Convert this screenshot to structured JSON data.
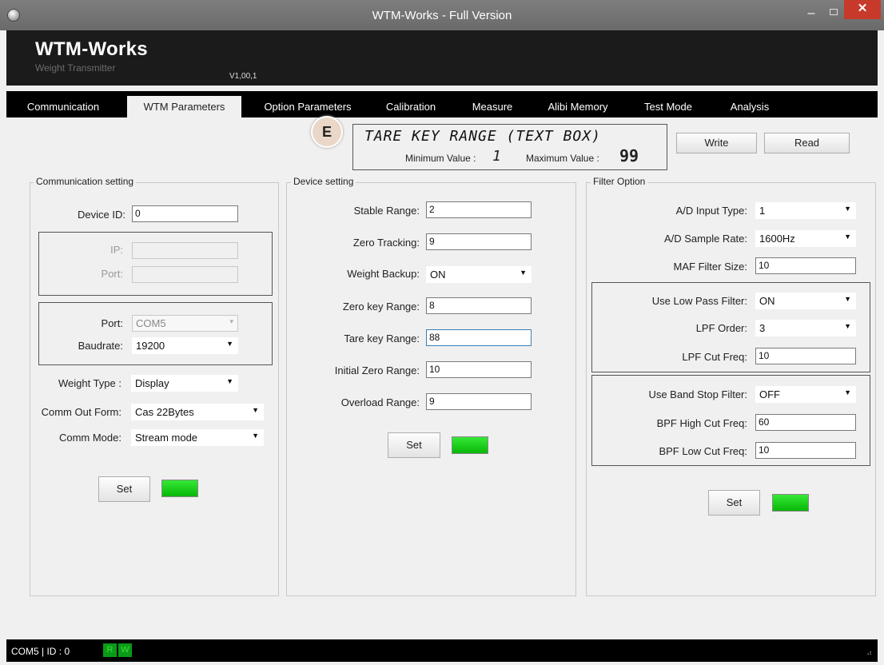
{
  "window": {
    "title": "WTM-Works - Full Version"
  },
  "header": {
    "name": "WTM-Works",
    "subtitle": "Weight Transmitter",
    "version": "V1,00,1"
  },
  "tabs": [
    "Communication",
    "WTM Parameters",
    "Option Parameters",
    "Calibration",
    "Measure",
    "Alibi Memory",
    "Test Mode",
    "Analysis"
  ],
  "active_tab": "WTM Parameters",
  "info_box": {
    "badge": "E",
    "title": "TARE KEY RANGE (TEXT BOX)",
    "min_label": "Minimum Value :",
    "min_value": "1",
    "max_label": "Maximum Value :",
    "max_value": "99"
  },
  "toolbar": {
    "write_label": "Write",
    "read_label": "Read"
  },
  "communication": {
    "legend": "Communication setting",
    "device_id_label": "Device ID:",
    "device_id_value": "0",
    "ip_label": "IP:",
    "ip_value": "",
    "port_net_label": "Port:",
    "port_net_value": "",
    "port_label": "Port:",
    "port_value": "COM5",
    "baudrate_label": "Baudrate:",
    "baudrate_value": "19200",
    "weight_type_label": "Weight Type :",
    "weight_type_value": "Display",
    "comm_out_label": "Comm Out Form:",
    "comm_out_value": "Cas 22Bytes",
    "comm_mode_label": "Comm Mode:",
    "comm_mode_value": "Stream mode",
    "set_label": "Set"
  },
  "device": {
    "legend": "Device setting",
    "stable_label": "Stable Range:",
    "stable_value": "2",
    "zero_tracking_label": "Zero Tracking:",
    "zero_tracking_value": "9",
    "weight_backup_label": "Weight Backup:",
    "weight_backup_value": "ON",
    "zero_key_label": "Zero key Range:",
    "zero_key_value": "8",
    "tare_key_label": "Tare key Range:",
    "tare_key_value": "88",
    "initial_zero_label": "Initial Zero Range:",
    "initial_zero_value": "10",
    "overload_label": "Overload Range:",
    "overload_value": "9",
    "set_label": "Set"
  },
  "filter": {
    "legend": "Filter Option",
    "ad_input_label": "A/D Input Type:",
    "ad_input_value": "1",
    "ad_sample_label": "A/D Sample Rate:",
    "ad_sample_value": "1600Hz",
    "maf_label": "MAF Filter Size:",
    "maf_value": "10",
    "lpf_use_label": "Use Low Pass Filter:",
    "lpf_use_value": "ON",
    "lpf_order_label": "LPF Order:",
    "lpf_order_value": "3",
    "lpf_cut_label": "LPF Cut Freq:",
    "lpf_cut_value": "10",
    "bsf_use_label": "Use Band Stop Filter:",
    "bsf_use_value": "OFF",
    "bpf_high_label": "BPF High Cut Freq:",
    "bpf_high_value": "60",
    "bpf_low_label": "BPF Low Cut Freq:",
    "bpf_low_value": "10",
    "set_label": "Set"
  },
  "status_bar": {
    "text": "COM5 | ID : 0",
    "r_label": "R",
    "w_label": "W"
  },
  "colors": {
    "led_green": "#19d419",
    "close_red": "#c7392b",
    "header_black": "#1b1b1b"
  }
}
